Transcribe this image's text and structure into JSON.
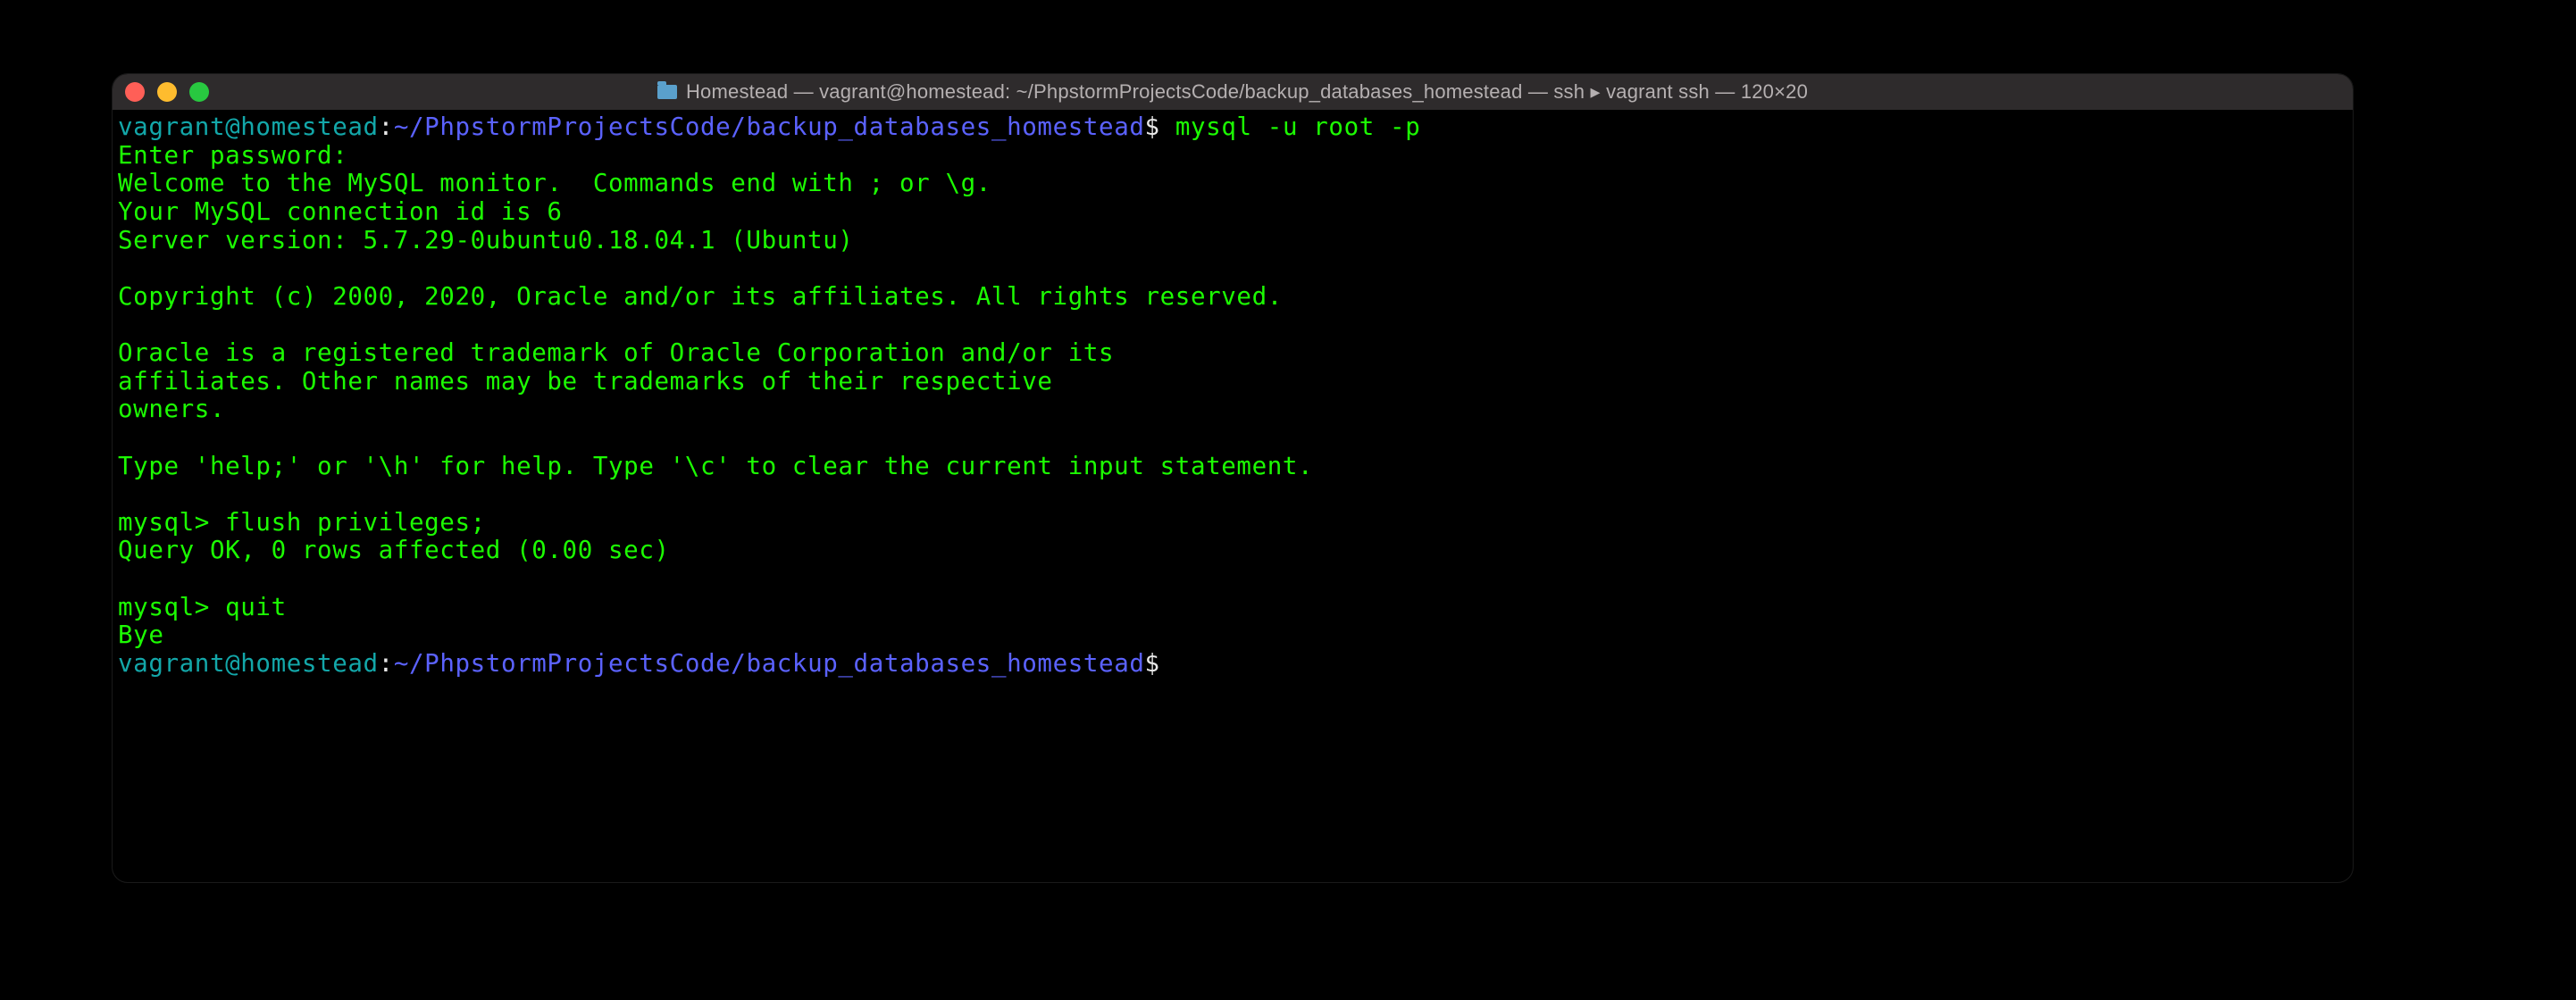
{
  "window": {
    "title": "Homestead — vagrant@homestead: ~/PhpstormProjectsCode/backup_databases_homestead — ssh ▸ vagrant ssh — 120×20"
  },
  "prompt1": {
    "user": "vagrant@homestead",
    "colon": ":",
    "path": "~/PhpstormProjectsCode/backup_databases_homestead",
    "dollar": "$",
    "cmd": " mysql -u root -p"
  },
  "lines": {
    "l1": "Enter password:",
    "l2": "Welcome to the MySQL monitor.  Commands end with ; or \\g.",
    "l3": "Your MySQL connection id is 6",
    "l4": "Server version: 5.7.29-0ubuntu0.18.04.1 (Ubuntu)",
    "l5": "",
    "l6": "Copyright (c) 2000, 2020, Oracle and/or its affiliates. All rights reserved.",
    "l7": "",
    "l8": "Oracle is a registered trademark of Oracle Corporation and/or its",
    "l9": "affiliates. Other names may be trademarks of their respective",
    "l10": "owners.",
    "l11": "",
    "l12": "Type 'help;' or '\\h' for help. Type '\\c' to clear the current input statement.",
    "l13": "",
    "l14": "mysql> flush privileges;",
    "l15": "Query OK, 0 rows affected (0.00 sec)",
    "l16": "",
    "l17": "mysql> quit",
    "l18": "Bye"
  },
  "prompt2": {
    "user": "vagrant@homestead",
    "colon": ":",
    "path": "~/PhpstormProjectsCode/backup_databases_homestead",
    "dollar": "$"
  }
}
